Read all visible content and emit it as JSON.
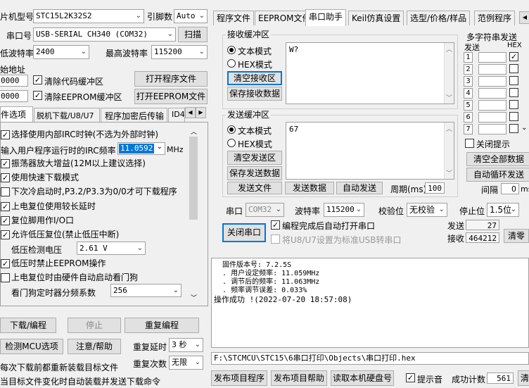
{
  "left": {
    "chip_label": "片机型号",
    "chip_value": "STC15L2K32S2",
    "pins_label": "引脚数",
    "pins_value": "Auto",
    "port_label": "串口号",
    "port_value": "USB-SERIAL CH340 (COM32)",
    "scan_btn": "扫描",
    "min_baud_label": "低波特率",
    "min_baud_value": "2400",
    "max_baud_label": "最高波特率",
    "max_baud_value": "115200",
    "start_addr_label": "始地址",
    "addr1": "0000",
    "addr2": "0000",
    "clear_code_label": "清除代码缓冲区",
    "clear_eeprom_label": "清除EEPROM缓冲区",
    "open_prog_btn": "打开程序文件",
    "open_eeprom_btn": "打开EEPROM文件",
    "tabs": [
      "件选项",
      "脱机下载/U8/U7",
      "程序加密后传输",
      "ID4"
    ],
    "options": [
      {
        "label": "选择使用内部IRC时钟(不选为外部时钟)",
        "checked": "✓"
      },
      {
        "label": "振荡器放大增益(12M以上建议选择)",
        "checked": "✓"
      },
      {
        "label": "使用快速下载模式",
        "checked": "✓"
      },
      {
        "label": "下次冷启动时,P3.2/P3.3为0/0才可下载程序",
        "checked": ""
      },
      {
        "label": "上电复位使用较长延时",
        "checked": "✓"
      },
      {
        "label": "复位脚用作I/O口",
        "checked": "✓"
      },
      {
        "label": "允许低压复位(禁止低压中断)",
        "checked": "✓"
      },
      {
        "label": "低压时禁止EEPROM操作",
        "checked": "✓"
      },
      {
        "label": "上电复位时由硬件自动启动看门狗",
        "checked": ""
      }
    ],
    "irc_label": "输入用户程序运行时的IRC频率",
    "irc_value": "11.0592",
    "irc_unit": "MHz",
    "lvd_label": "低压检测电压",
    "lvd_value": "2.61 V",
    "wdt_label": "看门狗定时器分频系数",
    "wdt_value": "256",
    "download_btn": "下载/编程",
    "stop_btn": "停止",
    "reprogram_btn": "重复编程",
    "detect_btn": "检测MCU选项",
    "help_btn": "注意/帮助",
    "repeat_delay_label": "重复延时",
    "repeat_delay_value": "3 秒",
    "repeat_count_label": "重复次数",
    "repeat_count_value": "无限",
    "reload_label": "每次下载前都重新装载目标文件",
    "auto_send_label": "当目标文件变化时自动装载并发送下载命令"
  },
  "right": {
    "tabs": [
      "程序文件",
      "EEPROM文件",
      "串口助手",
      "Keil仿真设置",
      "选型/价格/样品",
      "范例程序"
    ],
    "recv_title": "接收缓冲区",
    "text_mode": "文本模式",
    "hex_mode": "HEX模式",
    "clear_recv_btn": "清空接收区",
    "save_recv_btn": "保存接收数据",
    "recv_content": "W?",
    "send_title": "发送缓冲区",
    "clear_send_btn": "清空发送区",
    "save_send_btn": "保存发送数据",
    "send_content": "67",
    "send_file_btn": "发送文件",
    "send_data_btn": "发送数据",
    "auto_send_btn": "自动发送",
    "period_label": "周期(ms)",
    "period_value": "100",
    "multi_title": "多字符串发送",
    "multi_send_col": "发送",
    "multi_hex_col": "HEX",
    "multi_rows": [
      "1",
      "2",
      "3",
      "4",
      "5",
      "6",
      "7"
    ],
    "close_hint_label": "关闭提示",
    "clear_all_btn": "清空全部数据",
    "auto_loop_btn": "自动循环发送",
    "interval_label": "间隔",
    "interval_value": "0",
    "interval_unit": "ms",
    "com_label": "串口",
    "com_value": "COM32",
    "baud_label": "波特率",
    "baud_value": "115200",
    "parity_label": "校验位",
    "parity_value": "无校验",
    "stop_label": "停止位",
    "stop_value": "1.5位",
    "close_port_btn": "关闭串口",
    "auto_open_label": "编程完成后自动打开串口",
    "u8_label": "将U8/U7设置为标准USB转串口",
    "sent_label": "发送",
    "sent_value": "27",
    "recv_label": "接收",
    "recv_value": "464212",
    "clear_btn": "清零",
    "log_lines": [
      "  固件版本号: 7.2.5S",
      "",
      "  . 用户设定频率: 11.059MHz",
      "  . 调节后的频率: 11.063MHz",
      "  . 频率调节误差: 0.033%",
      "",
      "",
      "操作成功 !(2022-07-20 18:57:08)"
    ],
    "path": "F:\\STCMCU\\STC15\\6串口打印\\Objects\\串口打印.hex",
    "publish_btn": "发布项目程序",
    "publish_help_btn": "发布项目帮助",
    "read_disk_btn": "读取本机硬盘号",
    "beep_label": "提示音",
    "success_label": "成功计数",
    "success_value": "561",
    "clear2_btn": "清"
  }
}
